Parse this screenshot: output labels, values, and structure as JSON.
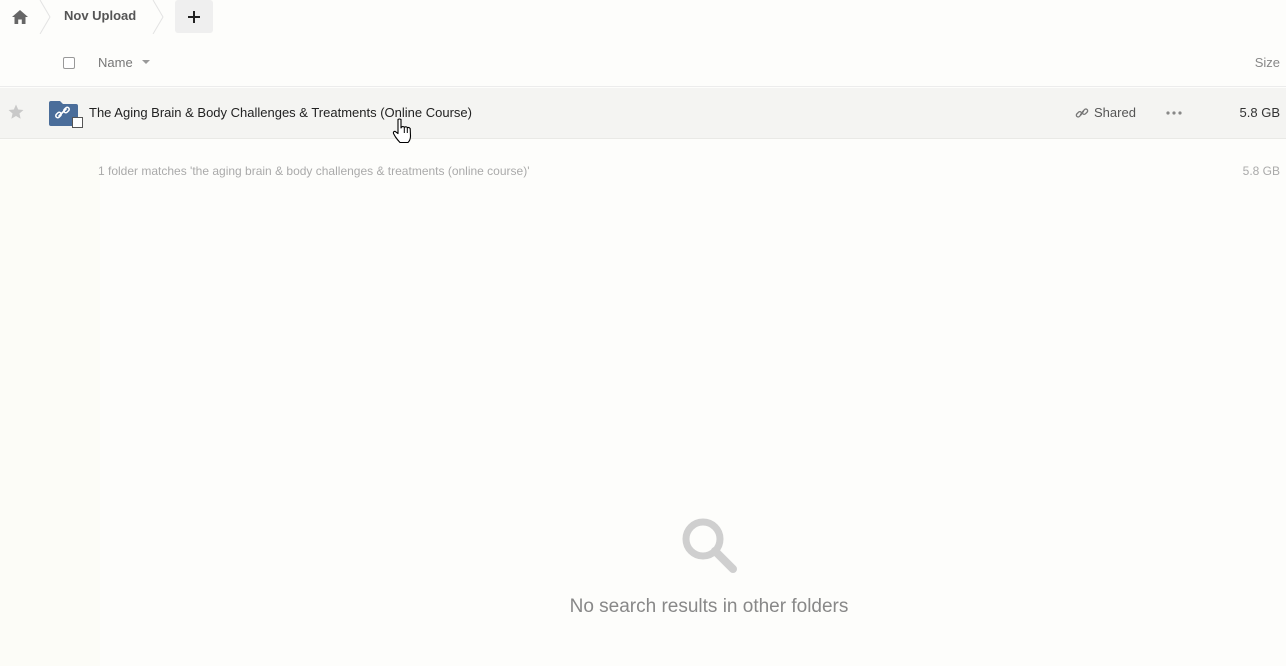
{
  "breadcrumb": {
    "home_icon": "home-icon",
    "current": "Nov Upload",
    "add_icon": "plus-icon"
  },
  "header": {
    "name_label": "Name",
    "size_label": "Size"
  },
  "files": [
    {
      "name": "The Aging Brain & Body Challenges & Treatments (Online Course)",
      "shared_label": "Shared",
      "size": "5.8 GB",
      "icon": "shared-folder-icon"
    }
  ],
  "summary": {
    "text": "1 folder matches 'the aging brain & body challenges & treatments (online course)'",
    "size": "5.8 GB"
  },
  "empty_state": {
    "message": "No search results in other folders",
    "icon": "search-icon"
  },
  "colors": {
    "folder": "#4a6d9a",
    "background": "#fdfdfb",
    "row_hover": "#f4f4f2"
  }
}
